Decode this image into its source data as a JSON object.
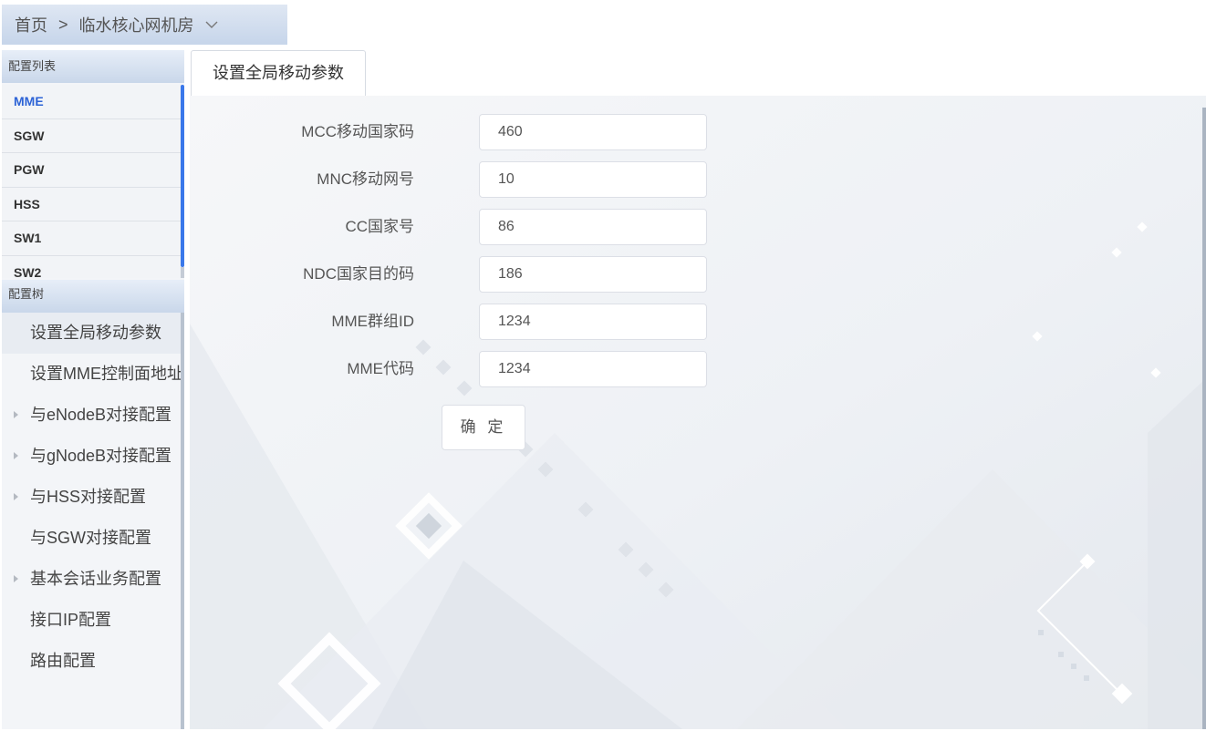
{
  "breadcrumb": {
    "home": "首页",
    "separator": ">",
    "current": "临水核心网机房"
  },
  "config_list": {
    "title": "配置列表",
    "items": [
      "MME",
      "SGW",
      "PGW",
      "HSS",
      "SW1",
      "SW2"
    ],
    "active": "MME"
  },
  "config_tree": {
    "title": "配置树",
    "items": [
      {
        "label": "设置全局移动参数",
        "expandable": false,
        "selected": true
      },
      {
        "label": "设置MME控制面地址",
        "expandable": false,
        "selected": false
      },
      {
        "label": "与eNodeB对接配置",
        "expandable": true,
        "selected": false
      },
      {
        "label": "与gNodeB对接配置",
        "expandable": true,
        "selected": false
      },
      {
        "label": "与HSS对接配置",
        "expandable": true,
        "selected": false
      },
      {
        "label": "与SGW对接配置",
        "expandable": false,
        "selected": false
      },
      {
        "label": "基本会话业务配置",
        "expandable": true,
        "selected": false
      },
      {
        "label": "接口IP配置",
        "expandable": false,
        "selected": false
      },
      {
        "label": "路由配置",
        "expandable": false,
        "selected": false
      }
    ]
  },
  "main": {
    "tab_label": "设置全局移动参数",
    "form": [
      {
        "label": "MCC移动国家码",
        "value": "460"
      },
      {
        "label": "MNC移动网号",
        "value": "10"
      },
      {
        "label": "CC国家号",
        "value": "86"
      },
      {
        "label": "NDC国家目的码",
        "value": "186"
      },
      {
        "label": "MME群组ID",
        "value": "1234"
      },
      {
        "label": "MME代码",
        "value": "1234"
      }
    ],
    "confirm_label": "确 定"
  },
  "colors": {
    "accent": "#2d63d6",
    "header_gradient_top": "#dfe7f3",
    "header_gradient_bottom": "#c6d5ea"
  }
}
